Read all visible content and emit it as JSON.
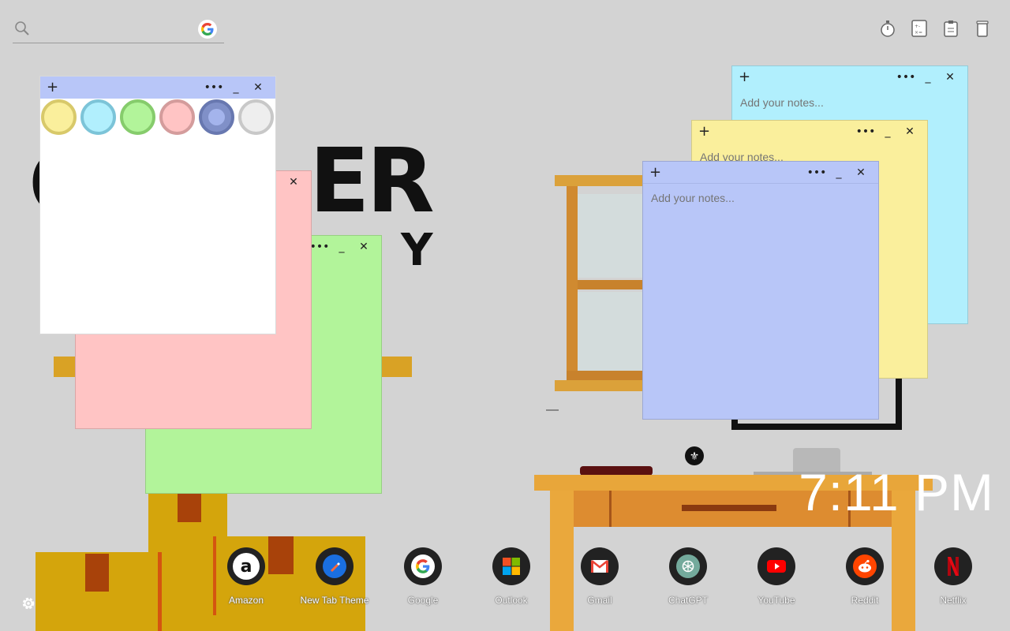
{
  "search": {
    "placeholder": ""
  },
  "background": {
    "headline_letters": "ER",
    "subline_letters": "Y",
    "headline_left_fragment": "C"
  },
  "notes": {
    "palette": {
      "colors": [
        "#faef9c",
        "#b1effd",
        "#b2f49a",
        "#ffc4c4",
        "#b8c6f8",
        "#eeeeee"
      ],
      "swatch_borders": [
        "#d8c96a",
        "#7cc4d8",
        "#86cc6c",
        "#d49c9c",
        "#8090c8",
        "#c8c8c8"
      ],
      "selected_index": 4
    },
    "add_label": "+",
    "menu_label": "•••",
    "minimize_label": "_",
    "close_label": "✕",
    "placeholder": "Add your notes..."
  },
  "clock": {
    "time": "7:11 PM"
  },
  "dock": [
    {
      "label": "Amazon",
      "icon": "amazon-icon"
    },
    {
      "label": "New Tab Theme",
      "icon": "new-tab-theme-icon"
    },
    {
      "label": "Google",
      "icon": "google-icon"
    },
    {
      "label": "Outlook",
      "icon": "outlook-icon"
    },
    {
      "label": "Gmail",
      "icon": "gmail-icon"
    },
    {
      "label": "ChatGPT",
      "icon": "chatgpt-icon"
    },
    {
      "label": "YouTube",
      "icon": "youtube-icon"
    },
    {
      "label": "Reddit",
      "icon": "reddit-icon"
    },
    {
      "label": "Netflix",
      "icon": "netflix-icon"
    }
  ],
  "colors": {
    "background": "#d3d3d3",
    "note_blue": "#b8c6f8",
    "note_yellow": "#faef9c",
    "note_cyan": "#b1effd",
    "note_pink": "#ffc4c4",
    "note_green": "#b2f49a",
    "note_white": "#ffffff"
  }
}
